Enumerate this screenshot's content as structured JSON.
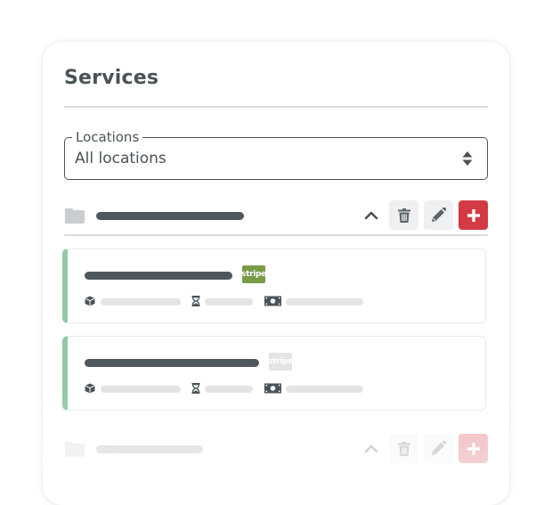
{
  "panel": {
    "title": "Services"
  },
  "location_filter": {
    "label": "Locations",
    "value": "All locations",
    "icon": "sort-arrows-icon"
  },
  "groups": [
    {
      "name_placeholder": "skeleton",
      "expanded": true,
      "icons": {
        "folder": "folder-icon",
        "toggle": "chevron-up-icon"
      },
      "actions": [
        {
          "name": "delete",
          "icon": "trash-icon"
        },
        {
          "name": "edit",
          "icon": "pencil-icon"
        },
        {
          "name": "add",
          "icon": "plus-icon"
        }
      ],
      "services": [
        {
          "name_placeholder": "skeleton",
          "badge": "stripe",
          "badge_active": true,
          "badge_color": "#7a9b48",
          "accent_color": "#93c9a2",
          "meta_icons": [
            "box-icon",
            "hourglass-icon",
            "money-icon"
          ]
        },
        {
          "name_placeholder": "skeleton",
          "badge": "stripe",
          "badge_active": false,
          "badge_color": "#e2e4e5",
          "accent_color": "#93c9a2",
          "meta_icons": [
            "box-icon",
            "hourglass-icon",
            "money-icon"
          ]
        }
      ]
    },
    {
      "name_placeholder": "skeleton",
      "expanded": false,
      "faded": true,
      "icons": {
        "folder": "folder-icon",
        "toggle": "chevron-up-icon"
      },
      "actions": [
        {
          "name": "delete",
          "icon": "trash-icon"
        },
        {
          "name": "edit",
          "icon": "pencil-icon"
        },
        {
          "name": "add",
          "icon": "plus-icon"
        }
      ]
    }
  ],
  "colors": {
    "text": "#4b5358",
    "danger": "#d33a43",
    "success_accent": "#93c9a2",
    "stripe_active": "#7a9b48"
  }
}
